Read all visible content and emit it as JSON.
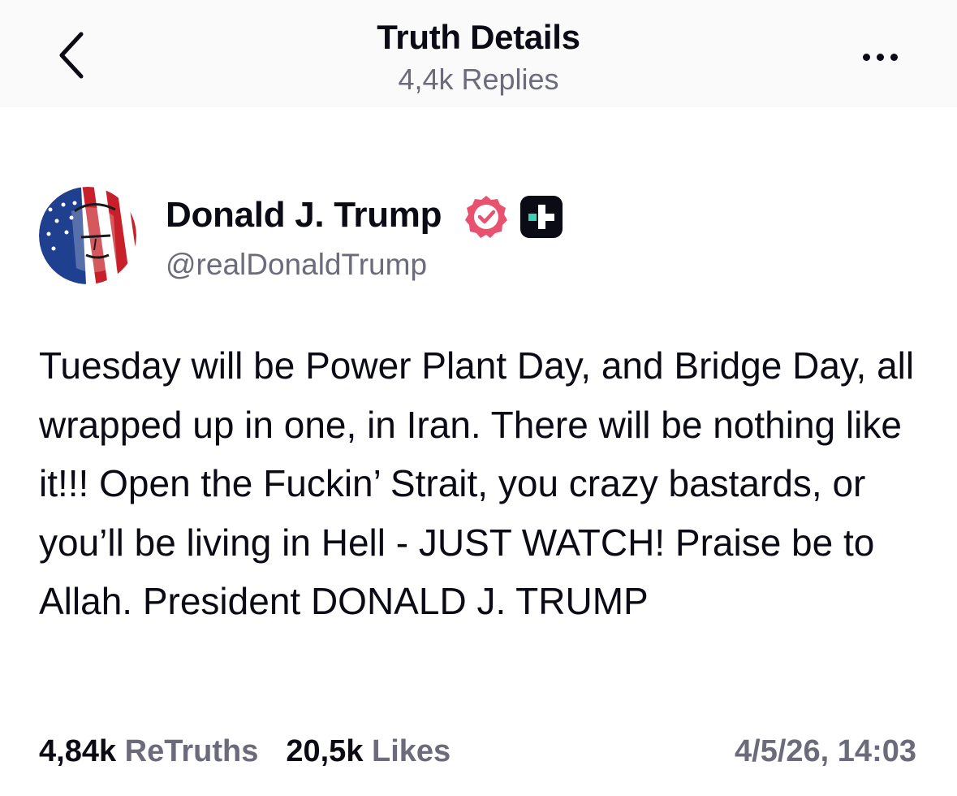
{
  "header": {
    "title": "Truth Details",
    "subtitle": "4,4k Replies",
    "back_icon": "chevron-left-icon",
    "more_icon": "ellipsis-icon"
  },
  "author": {
    "name": "Donald J. Trump",
    "handle": "@realDonaldTrump",
    "verified_icon": "verified-badge-icon",
    "verified_color": "#e8526f",
    "plus_icon": "truth-plus-badge-icon",
    "plus_color": "#3cd0b4"
  },
  "post": {
    "text": "Tuesday will be Power Plant Day, and Bridge Day, all wrapped up in one, in Iran. There will be nothing like it!!! Open the Fuckin’ Strait, you crazy bastards, or you’ll be living in Hell - JUST WATCH! Praise be to Allah. President DONALD J. TRUMP"
  },
  "stats": {
    "retruths_count": "4,84k",
    "retruths_label": "ReTruths",
    "likes_count": "20,5k",
    "likes_label": "Likes",
    "timestamp": "4/5/26, 14:03"
  },
  "colors": {
    "text_primary": "#0b0b16",
    "text_secondary": "#6b6b7b",
    "header_bg": "#fafafb"
  }
}
